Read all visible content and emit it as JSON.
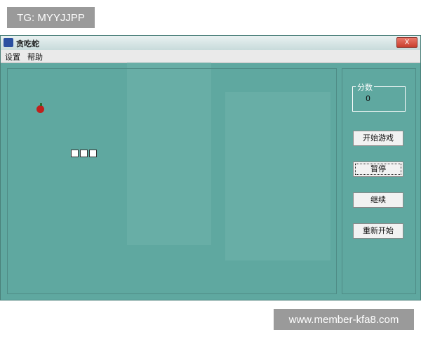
{
  "watermarks": {
    "top": "TG: MYYJJPP",
    "bottom": "www.member-kfa8.com"
  },
  "window": {
    "title": "贪吃蛇",
    "close_label": "X"
  },
  "menu": {
    "items": [
      "设置",
      "帮助"
    ]
  },
  "panel": {
    "score_label": "分数",
    "score_value": "0",
    "buttons": [
      "开始游戏",
      "暂停",
      "继续",
      "重新开始"
    ]
  },
  "colors": {
    "background": "#5fa8a0",
    "snake": "#ffffff",
    "food": "#c0201c"
  },
  "game": {
    "snake_length": 3
  }
}
